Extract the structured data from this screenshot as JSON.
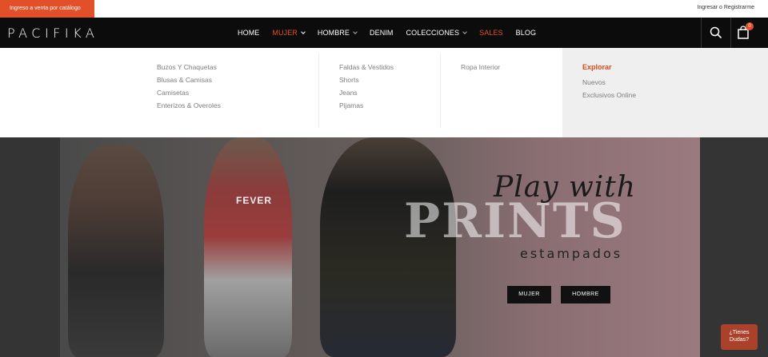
{
  "topbar": {
    "catalog_label": "Ingreso a venta por catálogo",
    "login_label": "Ingresar o Registrarme"
  },
  "header": {
    "logo": "PACIFIKA",
    "nav": [
      {
        "label": "HOME"
      },
      {
        "label": "MUJER"
      },
      {
        "label": "HOMBRE"
      },
      {
        "label": "DENIM"
      },
      {
        "label": "COLECCIONES"
      },
      {
        "label": "SALES"
      },
      {
        "label": "BLOG"
      }
    ],
    "cart_count": "0"
  },
  "mega_menu": {
    "col1": [
      "Buzos Y Chaquetas",
      "Blusas & Camisas",
      "Camisetas",
      "Enterizos & Overoles"
    ],
    "col2": [
      "Faldas & Vestidos",
      "Shorts",
      "Jeans",
      "Pijamas"
    ],
    "col3": [
      "Ropa Interior"
    ],
    "explore": {
      "title": "Explorar",
      "items": [
        "Nuevos",
        "Exclusivos Online"
      ]
    }
  },
  "hero": {
    "bg_text": "PRINTS",
    "headline": "Play with",
    "subline": "estampados",
    "shirt_text": "FEVER",
    "buttons": [
      "MUJER",
      "HOMBRE"
    ]
  },
  "chat": {
    "label_line1": "¿Tienes",
    "label_line2": "Dudas?"
  },
  "colors": {
    "accent": "#e2502a",
    "header_bg": "#0c0c0c",
    "explore_bg": "#efefef"
  }
}
